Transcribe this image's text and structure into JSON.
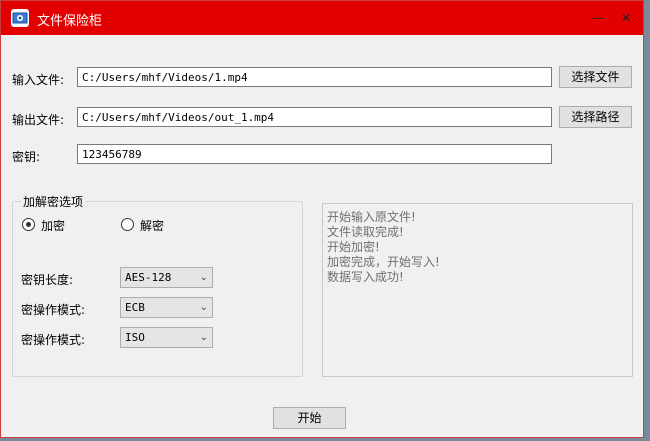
{
  "window": {
    "title": "文件保险柜",
    "minimize": "—",
    "close": "✕"
  },
  "input_file": {
    "label": "输入文件:",
    "value": "C:/Users/mhf/Videos/1.mp4",
    "button": "选择文件"
  },
  "output_file": {
    "label": "输出文件:",
    "value": "C:/Users/mhf/Videos/out_1.mp4",
    "button": "选择路径"
  },
  "key": {
    "label": "密钥:",
    "value": "123456789"
  },
  "options": {
    "title": "加解密选项",
    "encrypt_label": "加密",
    "decrypt_label": "解密",
    "selected": "加密",
    "key_length": {
      "label": "密钥长度:",
      "value": "AES-128"
    },
    "cipher_mode": {
      "label": "密操作模式:",
      "value": "ECB"
    },
    "padding_mode": {
      "label": "密操作模式:",
      "value": "ISO"
    }
  },
  "log": {
    "lines": [
      "开始输入原文件!",
      "文件读取完成!",
      "开始加密!",
      "加密完成，开始写入!",
      "数据写入成功!"
    ]
  },
  "start_button": "开始"
}
